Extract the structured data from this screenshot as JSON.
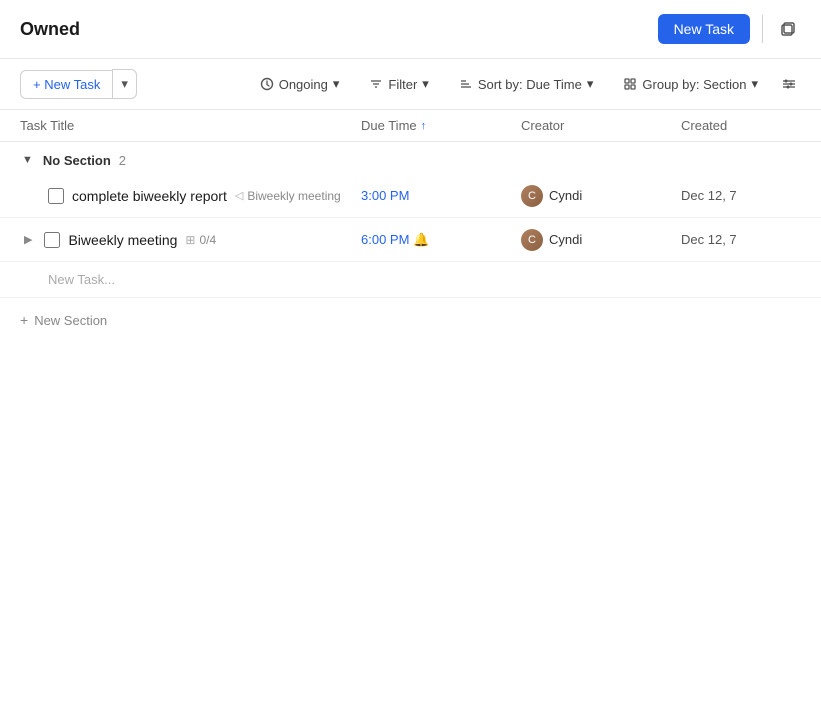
{
  "header": {
    "title": "Owned",
    "new_task_label": "New Task"
  },
  "toolbar": {
    "new_task_label": "+ New Task",
    "ongoing_label": "Ongoing",
    "filter_label": "Filter",
    "sort_label": "Sort by: Due Time",
    "group_label": "Group by: Section"
  },
  "table": {
    "columns": {
      "title": "Task Title",
      "due_time": "Due Time",
      "creator": "Creator",
      "created": "Created"
    }
  },
  "sections": [
    {
      "name": "No Section",
      "count": 2,
      "tasks": [
        {
          "id": "task-1",
          "name": "complete biweekly report",
          "tag": "Biweekly meeting",
          "due_time": "3:00 PM",
          "has_bell": false,
          "creator": "Cyndi",
          "created": "Dec 12, 7"
        },
        {
          "id": "task-2",
          "name": "Biweekly meeting",
          "subtask_count": "0/4",
          "due_time": "6:00 PM",
          "has_bell": true,
          "creator": "Cyndi",
          "created": "Dec 12, 7",
          "is_expandable": true
        }
      ]
    }
  ],
  "new_task_placeholder": "New Task...",
  "new_section_label": "New Section",
  "icons": {
    "expand": "▶",
    "collapse": "▼",
    "link": "◁",
    "subtask": "⊞",
    "bell": "🔔",
    "plus": "+",
    "sort_asc": "↑",
    "filter": "⊟",
    "sort": "↕",
    "group": "▦",
    "adjust": "⊟",
    "duplicate": "⧉",
    "dropdown": "▾"
  }
}
